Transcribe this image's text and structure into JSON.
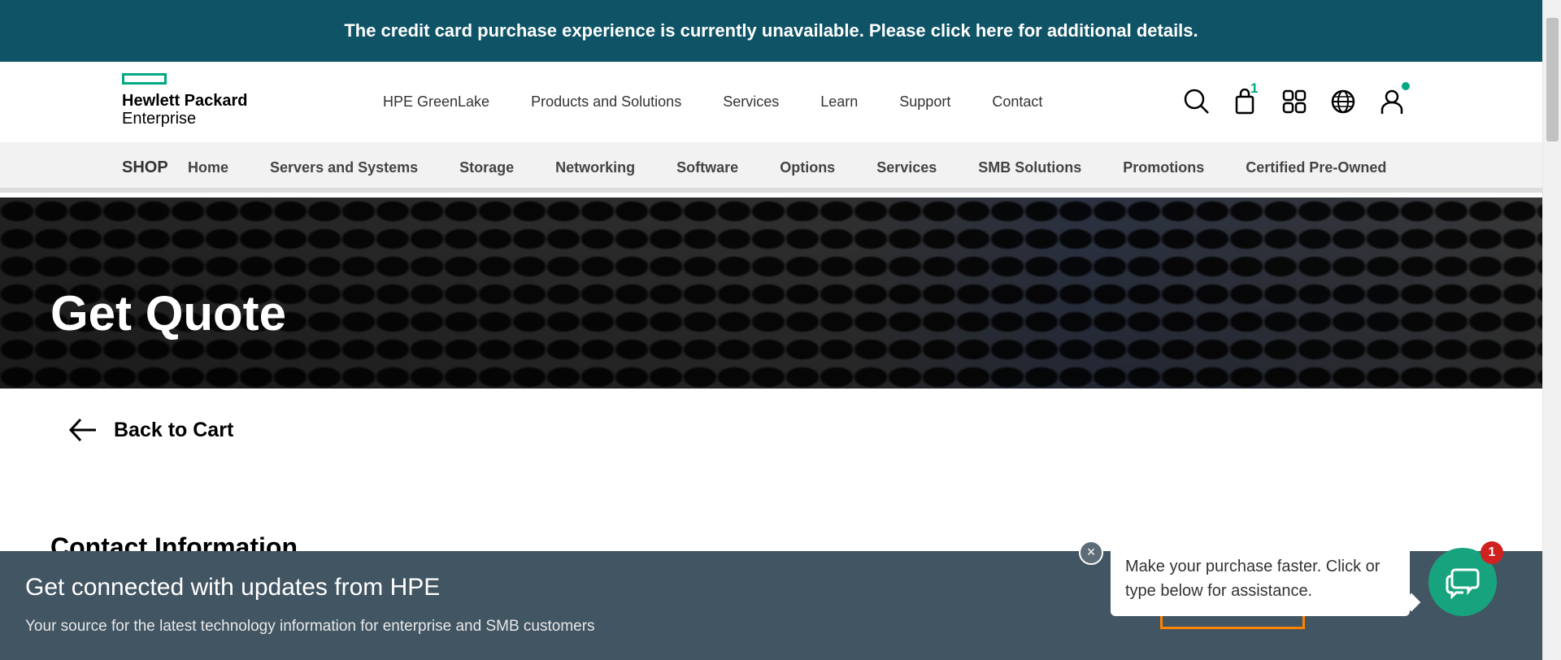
{
  "banner": {
    "text": "The credit card purchase experience is currently unavailable. Please click here for additional details."
  },
  "logo": {
    "line1": "Hewlett Packard",
    "line2": "Enterprise",
    "accent_color": "#01a982"
  },
  "main_nav": {
    "items": [
      "HPE GreenLake",
      "Products and Solutions",
      "Services",
      "Learn",
      "Support",
      "Contact"
    ]
  },
  "header_icons": {
    "search": "search-icon",
    "cart": "shopping-bag-icon",
    "cart_count": "1",
    "apps": "grid-icon",
    "language": "globe-icon",
    "account": "user-icon"
  },
  "shop_nav": {
    "label": "SHOP",
    "items": [
      "Home",
      "Servers and Systems",
      "Storage",
      "Networking",
      "Software",
      "Options",
      "Services",
      "SMB Solutions",
      "Promotions",
      "Certified Pre-Owned"
    ]
  },
  "hero": {
    "title": "Get Quote"
  },
  "back_link": {
    "label": "Back to Cart"
  },
  "section": {
    "title": "Contact Information"
  },
  "footer_banner": {
    "title": "Get connected with updates from HPE",
    "subtitle": "Your source for the latest technology information for enterprise and SMB customers"
  },
  "chat": {
    "message": "Make your purchase faster. Click or type below for assistance.",
    "badge_count": "1",
    "close_symbol": "×"
  },
  "colors": {
    "banner_bg": "#0f5366",
    "footer_bg": "#425563",
    "chat_green": "#17a37d",
    "badge_red": "#d0201f",
    "accent_orange": "#ff8300"
  }
}
